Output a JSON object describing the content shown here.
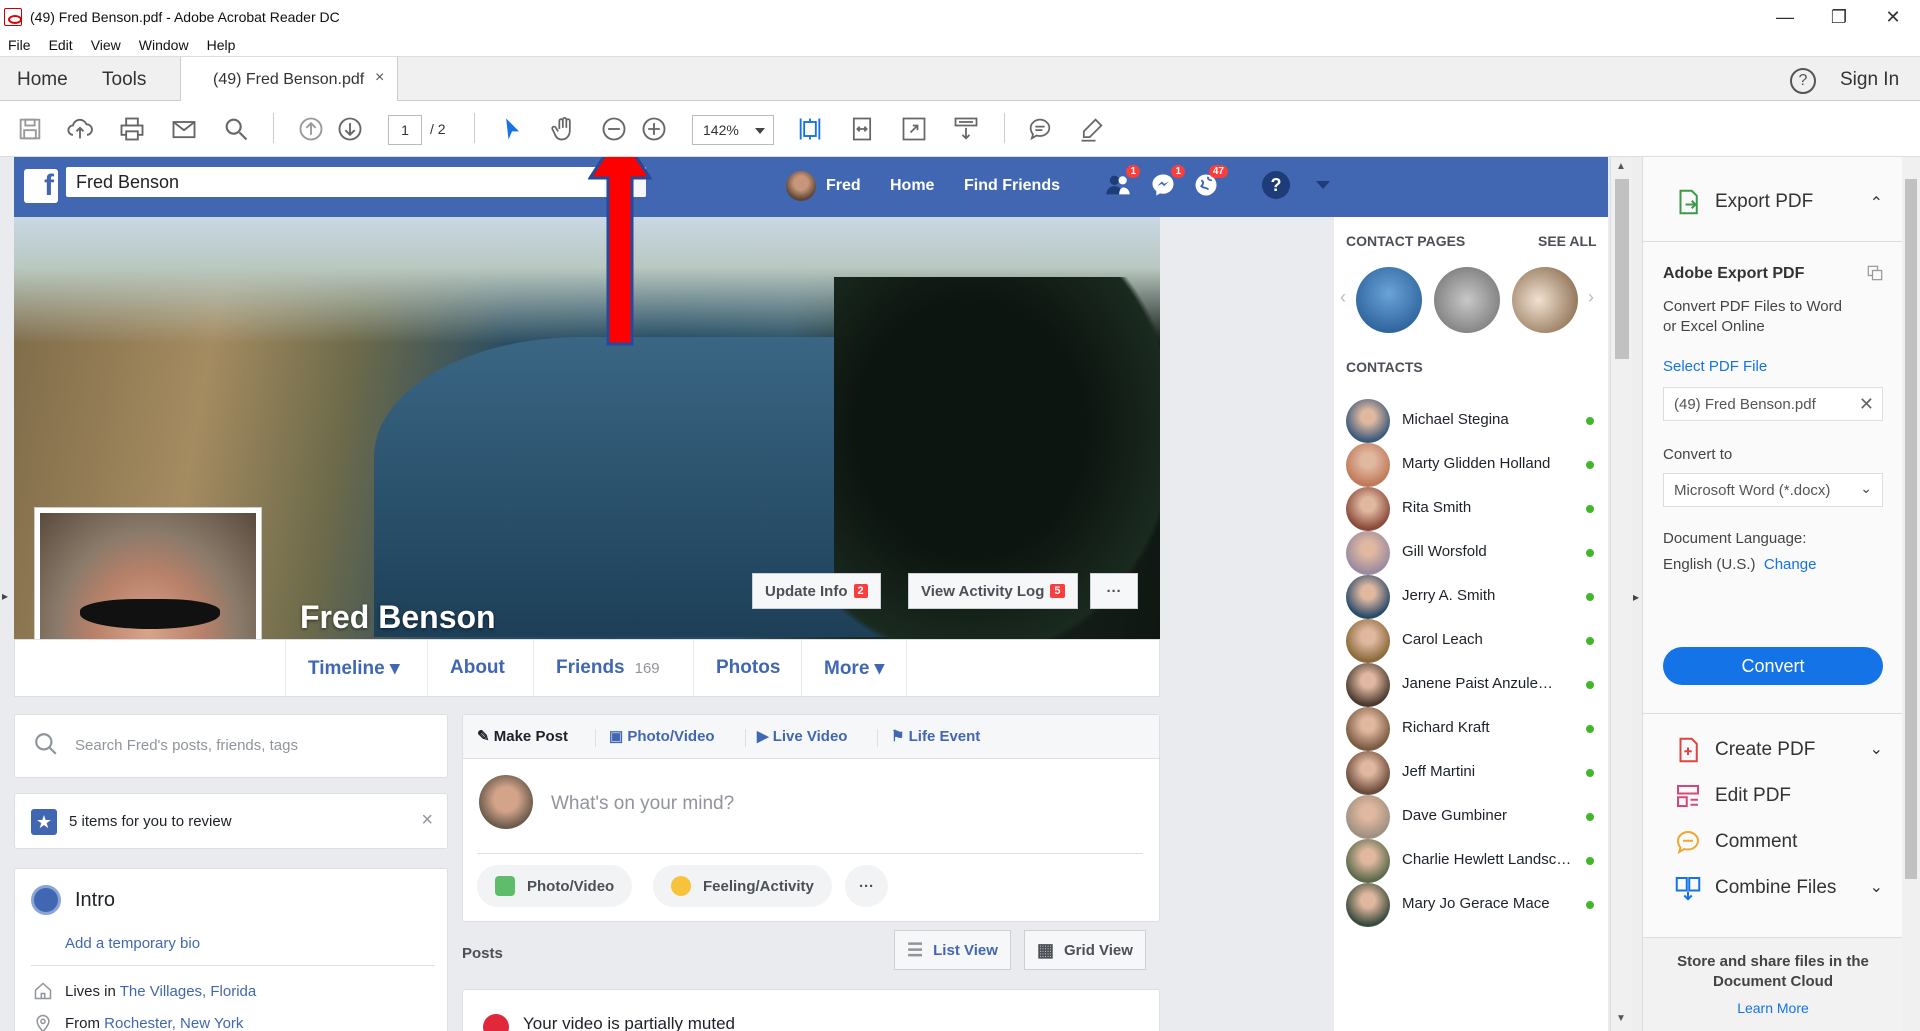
{
  "window": {
    "title": "(49) Fred Benson.pdf - Adobe Acrobat Reader DC",
    "minimize": "—",
    "restore": "❐",
    "close": "✕"
  },
  "menu": [
    "File",
    "Edit",
    "View",
    "Window",
    "Help"
  ],
  "tabs": {
    "home": "Home",
    "tools": "Tools",
    "document": "(49) Fred Benson.pdf",
    "document_close": "×",
    "help": "?",
    "sign_in": "Sign In"
  },
  "toolbar": {
    "page_current": "1",
    "page_total": "/ 2",
    "zoom": "142%"
  },
  "facebook": {
    "logo": "f",
    "search_value": "Fred Benson",
    "nav": {
      "user": "Fred",
      "home": "Home",
      "find_friends": "Find Friends"
    },
    "badges": {
      "friend_requests": "1",
      "messages": "1",
      "notifications": "47"
    },
    "help": "?",
    "profile_name": "Fred Benson",
    "cover_buttons": {
      "update_info": "Update Info",
      "update_info_count": "2",
      "activity_log": "View Activity Log",
      "activity_log_count": "5",
      "more": "···"
    },
    "profile_nav": {
      "timeline": "Timeline ▾",
      "about": "About",
      "friends": "Friends",
      "friends_count": "169",
      "photos": "Photos",
      "more": "More ▾"
    },
    "search_posts_placeholder": "Search Fred's posts, friends, tags",
    "review": {
      "text": "5 items for you to review",
      "close": "×"
    },
    "intro": {
      "title": "Intro",
      "add_bio": "Add a temporary bio",
      "lives_prefix": "Lives in ",
      "lives_place": "The Villages, Florida",
      "from_prefix": "From ",
      "from_place": "Rochester, New York"
    },
    "composer": {
      "tabs": [
        "Make Post",
        "Photo/Video",
        "Live Video",
        "Life Event"
      ],
      "placeholder": "What's on your mind?",
      "pills": [
        "Photo/Video",
        "Feeling/Activity",
        "···"
      ]
    },
    "posts": {
      "label": "Posts",
      "list_view": "List View",
      "grid_view": "Grid View"
    },
    "muted_notice": "Your video is partially muted",
    "contact_pages": {
      "heading": "CONTACT PAGES",
      "see_all": "SEE ALL"
    },
    "contacts_heading": "CONTACTS",
    "contacts": [
      "Michael Stegina",
      "Marty Glidden Holland",
      "Rita Smith",
      "Gill Worsfold",
      "Jerry A. Smith",
      "Carol Leach",
      "Janene Paist Anzule…",
      "Richard Kraft",
      "Jeff Martini",
      "Dave Gumbiner",
      "Charlie Hewlett Landsc…",
      "Mary Jo Gerace Mace"
    ]
  },
  "right_panel": {
    "export_pdf": "Export PDF",
    "adobe_export_title": "Adobe Export PDF",
    "adobe_export_desc_1": "Convert PDF Files to Word",
    "adobe_export_desc_2": "or Excel Online",
    "select_file": "Select PDF File",
    "file_name": "(49) Fred Benson.pdf",
    "convert_to_label": "Convert to",
    "convert_to_value": "Microsoft Word (*.docx)",
    "doc_lang_label": "Document Language:",
    "doc_lang_value": "English (U.S.)",
    "change": "Change",
    "convert_button": "Convert",
    "tools": [
      "Create PDF",
      "Edit PDF",
      "Comment",
      "Combine Files"
    ],
    "footer_text": "Store and share files in the Document Cloud",
    "learn_more": "Learn More"
  },
  "colors": {
    "facebook_blue": "#4267b2",
    "acrobat_blue": "#1473e6",
    "annotation_red": "#ff0000",
    "online_green": "#42b72a"
  }
}
